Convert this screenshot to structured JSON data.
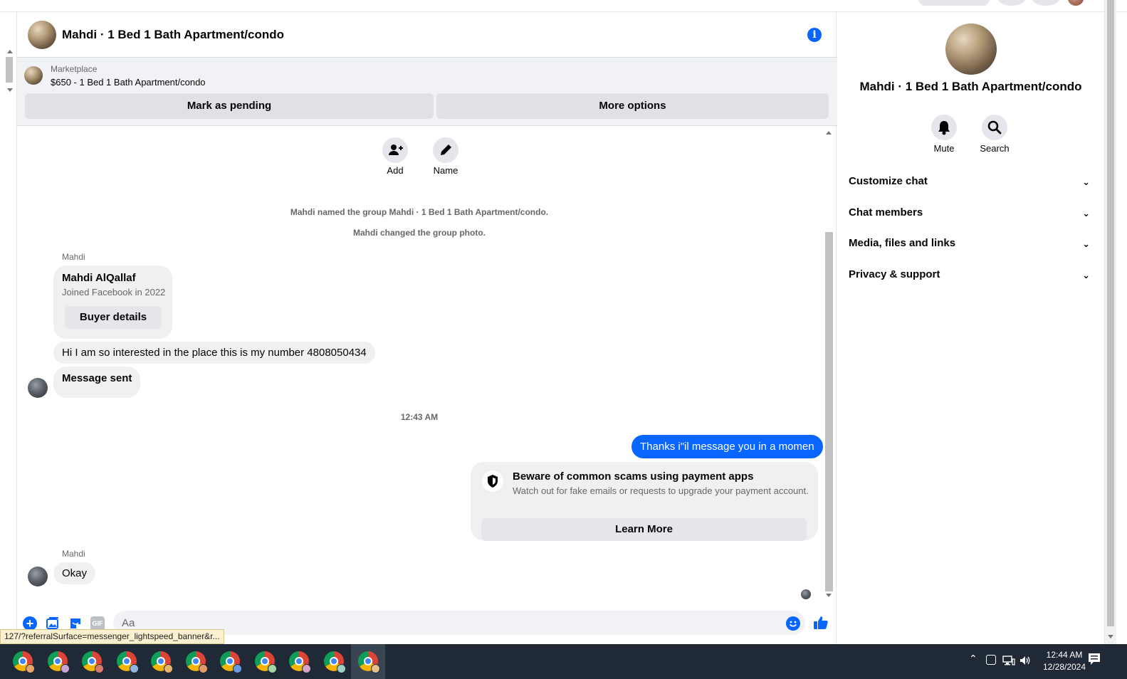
{
  "header": {
    "title": "Mahdi · 1 Bed 1 Bath Apartment/condo"
  },
  "listing": {
    "source": "Marketplace",
    "title": "$650 - 1 Bed 1 Bath Apartment/condo",
    "mark_pending_label": "Mark as pending",
    "more_options_label": "More options"
  },
  "group_actions": {
    "add_label": "Add",
    "name_label": "Name"
  },
  "system_messages": [
    "Mahdi named the group Mahdi · 1 Bed 1 Bath Apartment/condo.",
    "Mahdi changed the group photo."
  ],
  "messages": {
    "sender_1": "Mahdi",
    "profile_name": "Mahdi AlQallaf",
    "profile_joined": "Joined Facebook in 2022",
    "buyer_details_label": "Buyer details",
    "msg_1": "Hi I am so interested in the place this is my number 4808050434",
    "msg_2": "Message sent",
    "timestamp": "12:43 AM",
    "outgoing_1": "Thanks i\"il message you in a momen",
    "scam_title": "Beware of common scams using payment apps",
    "scam_body": "Watch out for fake emails or requests to upgrade your payment account.",
    "learn_more_label": "Learn More",
    "sender_2": "Mahdi",
    "msg_3": "Okay"
  },
  "composer": {
    "placeholder": "Aa",
    "gif_label": "GIF"
  },
  "side_panel": {
    "title": "Mahdi · 1 Bed 1 Bath Apartment/condo",
    "mute_label": "Mute",
    "search_label": "Search",
    "sections": [
      "Customize chat",
      "Chat members",
      "Media, files and links",
      "Privacy & support"
    ]
  },
  "status_url": "127/?referralSurface=messenger_lightspeed_banner&r...",
  "taskbar": {
    "time": "12:44 AM",
    "date": "12/28/2024"
  },
  "colors": {
    "accent": "#0866ff",
    "bubble_in": "#f0f0f0",
    "taskbar": "#202a36"
  }
}
